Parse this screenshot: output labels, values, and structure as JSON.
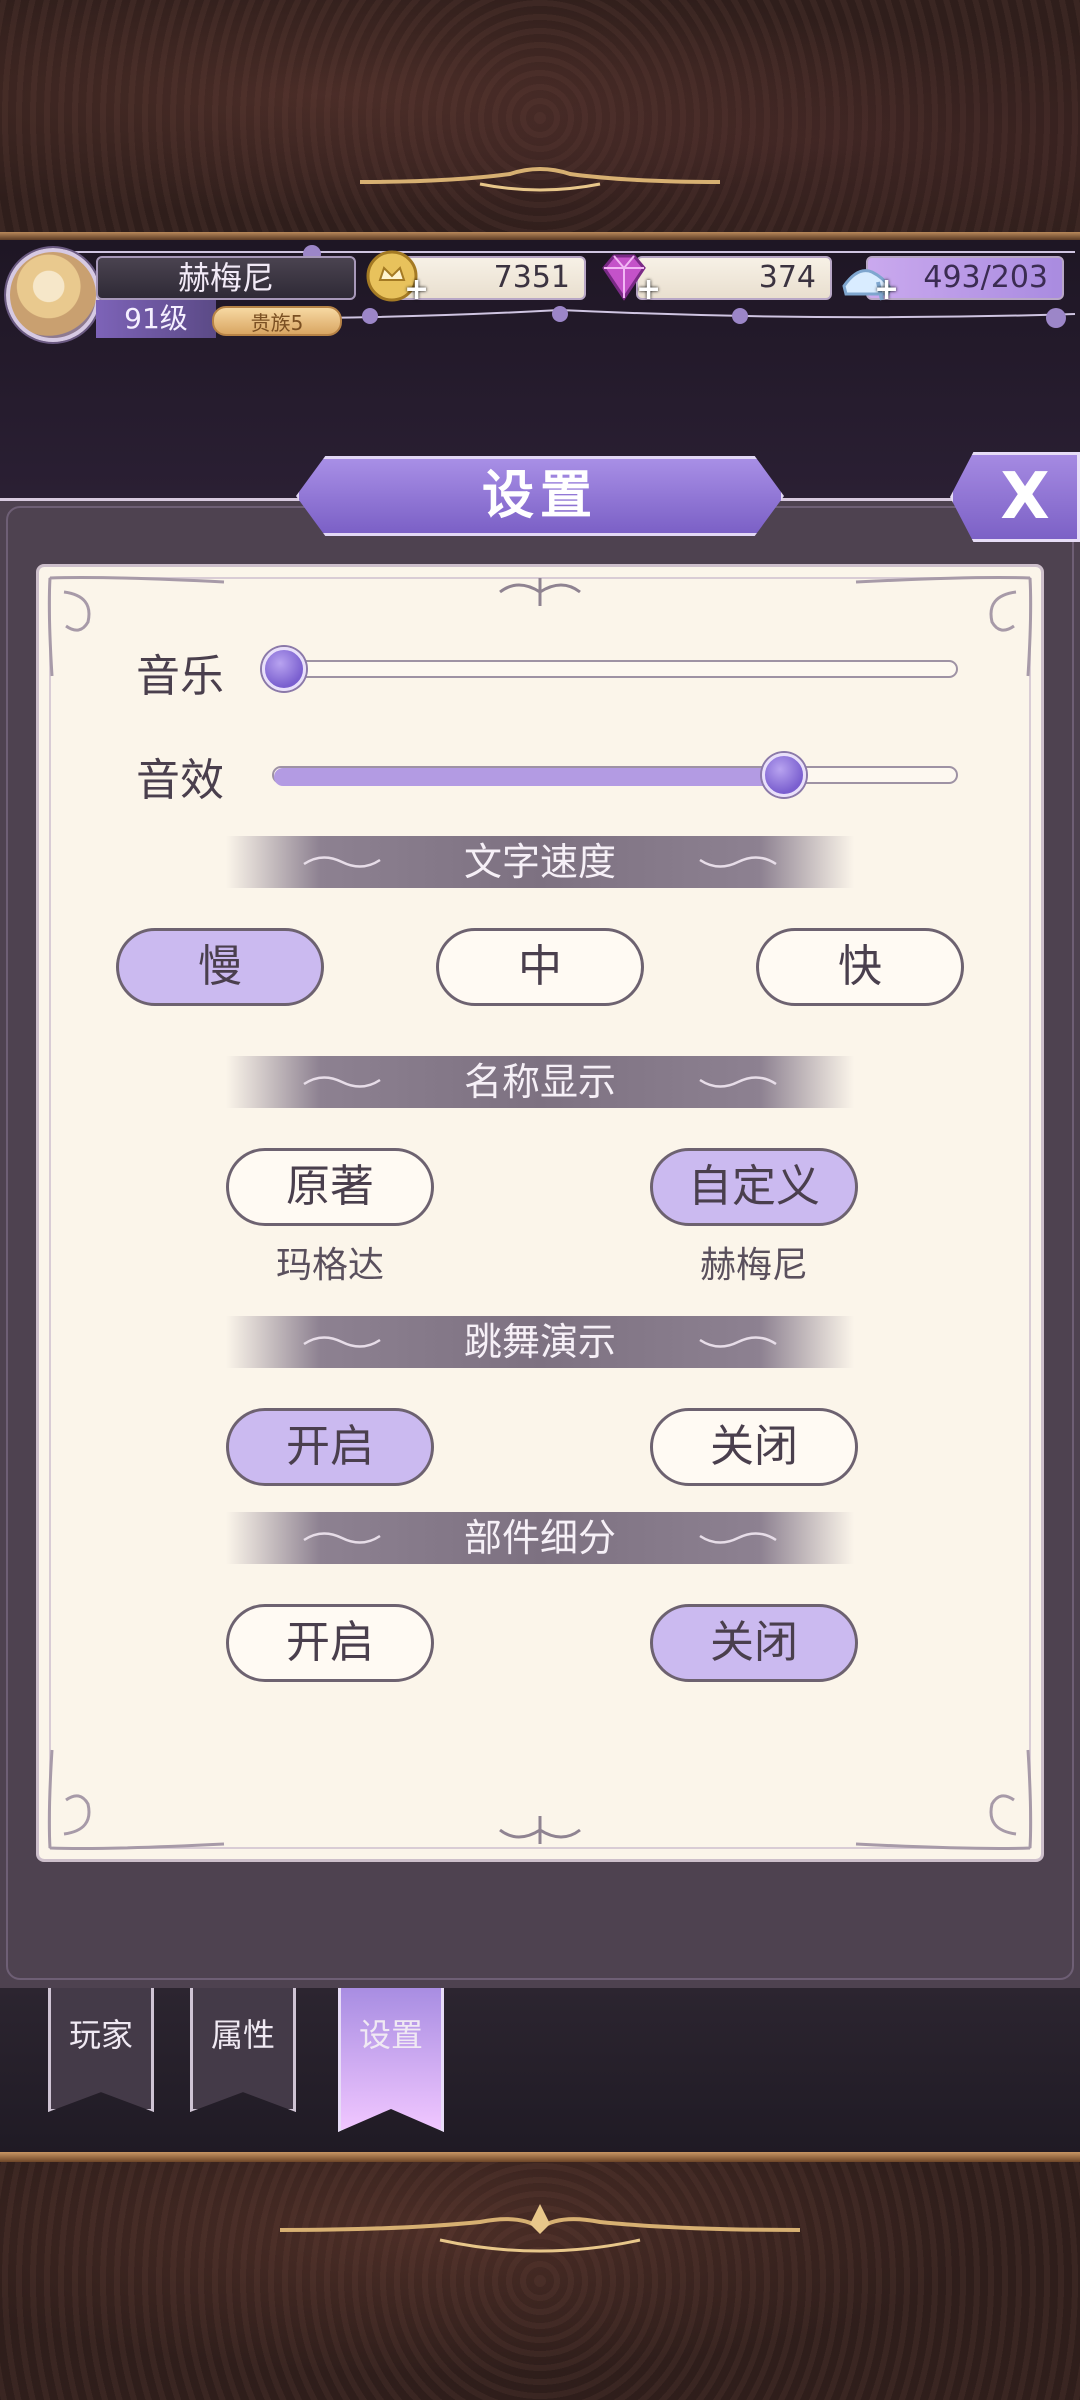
{
  "player": {
    "name": "赫梅尼",
    "level": "91级",
    "rank": "贵族5"
  },
  "resources": {
    "gold": "7351",
    "gems": "374",
    "stamina": "493/203",
    "plus": "+"
  },
  "dialog": {
    "title": "设置",
    "close": "X"
  },
  "sliders": {
    "music": {
      "label": "音乐",
      "value": 0.0
    },
    "sfx": {
      "label": "音效",
      "value": 0.75
    }
  },
  "sections": {
    "text_speed": {
      "title": "文字速度",
      "options": [
        "慢",
        "中",
        "快"
      ],
      "selected": "慢"
    },
    "name_display": {
      "title": "名称显示",
      "options": [
        "原著",
        "自定义"
      ],
      "sublabels": [
        "玛格达",
        "赫梅尼"
      ],
      "selected": "自定义"
    },
    "dance_demo": {
      "title": "跳舞演示",
      "options": [
        "开启",
        "关闭"
      ],
      "selected": "开启"
    },
    "parts_detail": {
      "title": "部件细分",
      "options": [
        "开启",
        "关闭"
      ],
      "selected": "关闭"
    }
  },
  "tabs": [
    "玩家",
    "属性",
    "设置"
  ],
  "active_tab": "设置",
  "colors": {
    "accent": "#a88fe6",
    "paper": "#fbf5ea",
    "selected": "#cbbaf0"
  }
}
